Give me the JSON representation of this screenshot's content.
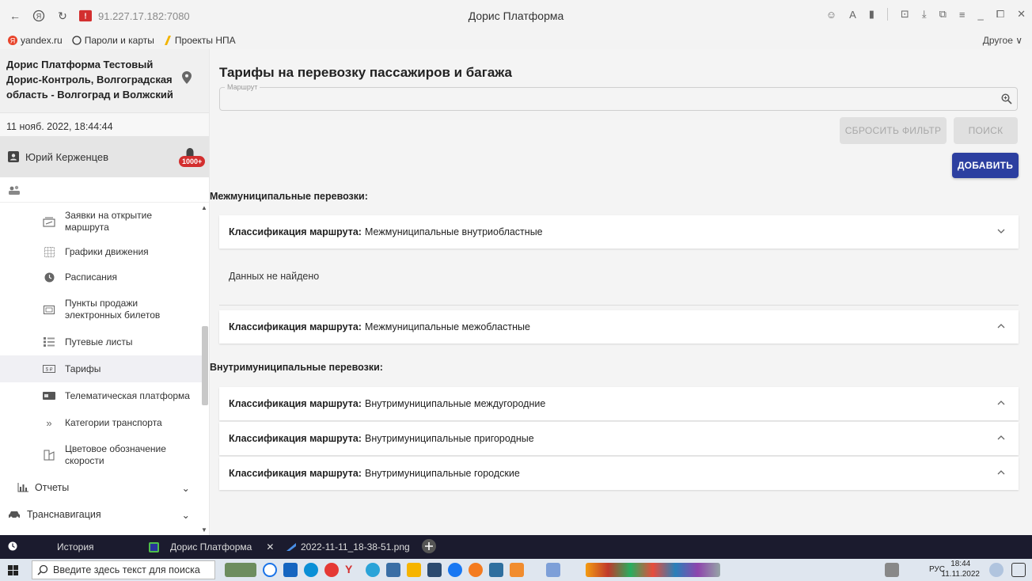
{
  "browser": {
    "url": "91.227.17.182:7080",
    "title": "Дорис Платформа",
    "bookmarks": [
      {
        "label": "yandex.ru",
        "icon": "yandex-icon"
      },
      {
        "label": "Пароли и карты",
        "icon": "key-icon"
      },
      {
        "label": "Проекты НПА",
        "icon": "bookmark-icon"
      }
    ],
    "bookmarks_other": "Другое ∨"
  },
  "sidebar": {
    "org_name": "Дорис Платформа Тестовый Дорис-Контроль, Волгоградская область - Волгоград и Волжский",
    "datetime": "11 нояб. 2022, 18:44:44",
    "user_name": "Юрий Керженцев",
    "badge": "1000+",
    "menu": [
      {
        "label": "Заявки на открытие маршрута",
        "icon": "request-icon"
      },
      {
        "label": "Графики движения",
        "icon": "grid-icon"
      },
      {
        "label": "Расписания",
        "icon": "clock-icon"
      },
      {
        "label": "Пункты продажи электронных билетов",
        "icon": "ticket-icon"
      },
      {
        "label": "Путевые листы",
        "icon": "list-icon"
      },
      {
        "label": "Тарифы",
        "icon": "tariff-icon"
      },
      {
        "label": "Телематическая платформа",
        "icon": "telematic-icon"
      },
      {
        "label": "Категории транспорта",
        "icon": "double-chevron-icon"
      },
      {
        "label": "Цветовое обозначение скорости",
        "icon": "color-icon"
      }
    ],
    "sections": [
      {
        "label": "Отчеты"
      },
      {
        "label": "Транснавигация"
      }
    ]
  },
  "main": {
    "title": "Тарифы на перевозку пассажиров и багажа",
    "route_legend": "Маршрут",
    "reset_label": "СБРОСИТЬ ФИЛЬТР",
    "search_label": "ПОИСК",
    "add_label": "ДОБАВИТЬ",
    "class_label": "Классификация маршрута:",
    "group1": "Межмуниципальные перевозки:",
    "group2": "Внутримуниципальные перевозки:",
    "acc1": "Межмуниципальные внутриобластные",
    "no_data": "Данных не найдено",
    "acc2": "Межмуниципальные межобластные",
    "acc3": "Внутримуниципальные междугородние",
    "acc4": "Внутримуниципальные пригородные",
    "acc5": "Внутримуниципальные городские"
  },
  "taskbar": {
    "history": "История",
    "tab1": "Дорис Платформа",
    "tab2": "2022-11-11_18-38-51.png",
    "search_placeholder": "Введите здесь текст для поиска",
    "lang": "РУС",
    "time": "18:44",
    "date": "11.11.2022"
  },
  "colors": {
    "primary": "#2c3fa0",
    "badge": "#d32f2f"
  }
}
